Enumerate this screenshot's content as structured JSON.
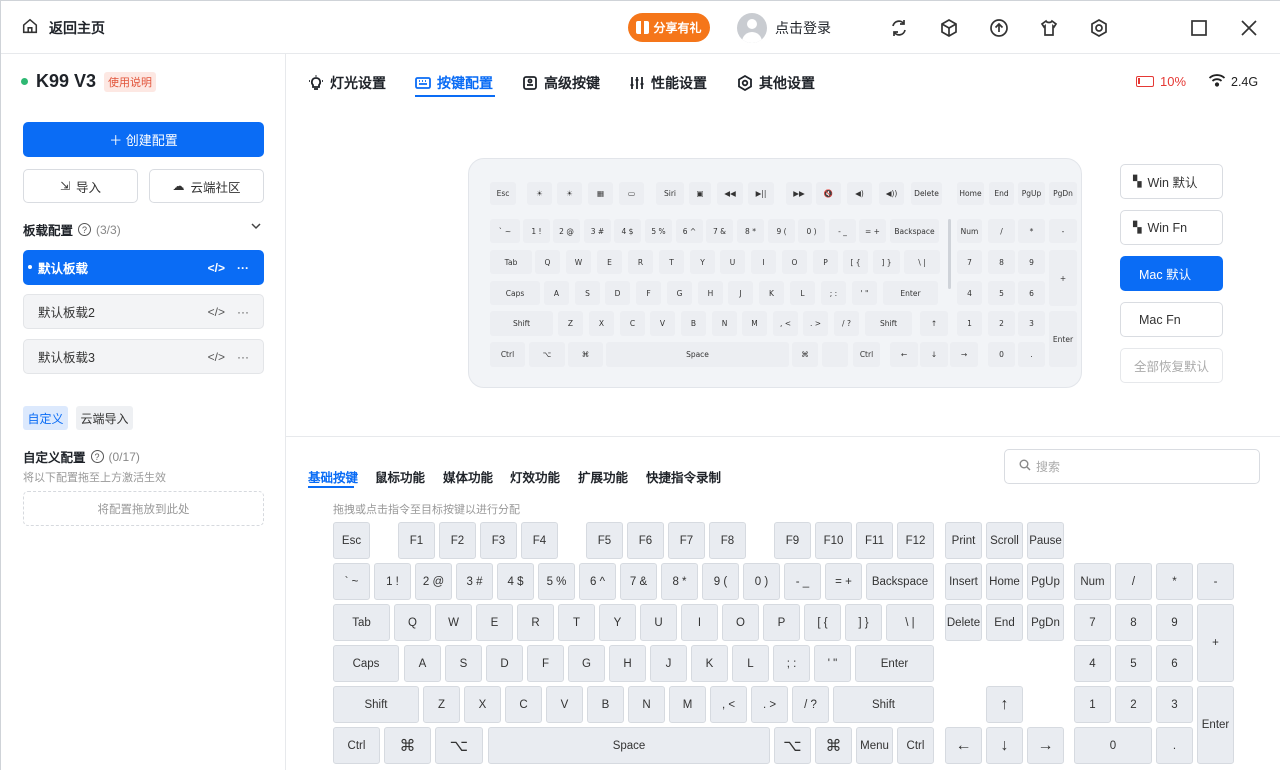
{
  "titlebar": {
    "home_label": "返回主页",
    "share_label": "分享有礼",
    "login_label": "点击登录",
    "share_color": "#f5761a"
  },
  "sidebar": {
    "device_name": "K99 V3",
    "manual_badge": "使用说明",
    "create_label": "＋ 创建配置",
    "import_label": "导入",
    "cloud_label": "云端社区",
    "board_section": "板载配置",
    "board_count": "(3/3)",
    "profiles": [
      {
        "label": "默认板载"
      },
      {
        "label": "默认板载2"
      },
      {
        "label": "默认板载3"
      }
    ],
    "custom_tab": "自定义",
    "cloud_import_tab": "云端导入",
    "custom_section": "自定义配置",
    "custom_count": "(0/17)",
    "custom_hint": "将以下配置拖至上方激活生效",
    "drop_label": "将配置拖放到此处"
  },
  "tabs": [
    {
      "label": "灯光设置",
      "icon": "bulb-icon"
    },
    {
      "label": "按键配置",
      "icon": "keyboard-icon"
    },
    {
      "label": "高级按键",
      "icon": "advanced-key-icon"
    },
    {
      "label": "性能设置",
      "icon": "sliders-icon"
    },
    {
      "label": "其他设置",
      "icon": "gear-icon"
    }
  ],
  "status": {
    "battery": "10%",
    "connection": "2.4G",
    "battery_color": "#e53935"
  },
  "modes": [
    {
      "label": "Win 默认",
      "icon": "windows-icon"
    },
    {
      "label": "Win Fn",
      "icon": "windows-icon"
    },
    {
      "label": "Mac 默认",
      "icon": "apple-icon"
    },
    {
      "label": "Mac Fn",
      "icon": "apple-icon"
    },
    {
      "label": "全部恢复默认",
      "icon": ""
    }
  ],
  "subtabs": [
    "基础按键",
    "鼠标功能",
    "媒体功能",
    "灯效功能",
    "扩展功能",
    "快捷指令录制"
  ],
  "search_placeholder": "搜索",
  "drag_hint": "拖拽或点击指令至目标按键以进行分配",
  "accent": "#0a6cf5",
  "preview": {
    "row0": [
      "Esc",
      "☀",
      "☀",
      "▦",
      "▭",
      "Siri",
      "▣",
      "◀◀",
      "▶||",
      "▶▶",
      "🔇",
      "◀)",
      "◀))",
      "Delete",
      "Home",
      "End",
      "PgUp",
      "PgDn"
    ],
    "row1": [
      "` ~",
      "1 !",
      "2 @",
      "3 #",
      "4 $",
      "5 %",
      "6 ^",
      "7 &",
      "8 *",
      "9 (",
      "0 )",
      "- _",
      "= +",
      "Backspace",
      "Num",
      "/",
      "*",
      "-"
    ],
    "row2": [
      "Tab",
      "Q",
      "W",
      "E",
      "R",
      "T",
      "Y",
      "U",
      "I",
      "O",
      "P",
      "[ {",
      "] }",
      "\\ |",
      "7",
      "8",
      "9",
      "+"
    ],
    "row3": [
      "Caps",
      "A",
      "S",
      "D",
      "F",
      "G",
      "H",
      "J",
      "K",
      "L",
      "; :",
      "' \"",
      "Enter",
      "4",
      "5",
      "6"
    ],
    "row4": [
      "Shift",
      "Z",
      "X",
      "C",
      "V",
      "B",
      "N",
      "M",
      ", <",
      ". >",
      "/ ?",
      "Shift",
      "↑",
      "1",
      "2",
      "3",
      "Enter"
    ],
    "row5": [
      "Ctrl",
      "⌥",
      "⌘",
      "Space",
      "⌘",
      "",
      "Ctrl",
      "←",
      "↓",
      "→",
      "0",
      "."
    ]
  },
  "keys": {
    "row0": [
      "Esc",
      "F1",
      "F2",
      "F3",
      "F4",
      "F5",
      "F6",
      "F7",
      "F8",
      "F9",
      "F10",
      "F11",
      "F12",
      "Print",
      "Scroll",
      "Pause"
    ],
    "row1": [
      "` ~",
      "1 !",
      "2 @",
      "3 #",
      "4 $",
      "5 %",
      "6 ^",
      "7 &",
      "8 *",
      "9 (",
      "0 )",
      "- _",
      "= +",
      "Backspace",
      "Insert",
      "Home",
      "PgUp",
      "Num",
      "/",
      "*",
      "-"
    ],
    "row2": [
      "Tab",
      "Q",
      "W",
      "E",
      "R",
      "T",
      "Y",
      "U",
      "I",
      "O",
      "P",
      "[ {",
      "] }",
      "\\ |",
      "Delete",
      "End",
      "PgDn",
      "7",
      "8",
      "9",
      "+"
    ],
    "row3": [
      "Caps",
      "A",
      "S",
      "D",
      "F",
      "G",
      "H",
      "J",
      "K",
      "L",
      "; :",
      "' \"",
      "Enter",
      "4",
      "5",
      "6"
    ],
    "row4": [
      "Shift",
      "Z",
      "X",
      "C",
      "V",
      "B",
      "N",
      "M",
      ", <",
      ". >",
      "/ ?",
      "Shift",
      "↑",
      "1",
      "2",
      "3",
      "Enter"
    ],
    "row5": [
      "Ctrl",
      "⌘",
      "⌥",
      "Space",
      "⌥",
      "⌘",
      "Menu",
      "Ctrl",
      "←",
      "↓",
      "→",
      "0",
      "."
    ]
  }
}
